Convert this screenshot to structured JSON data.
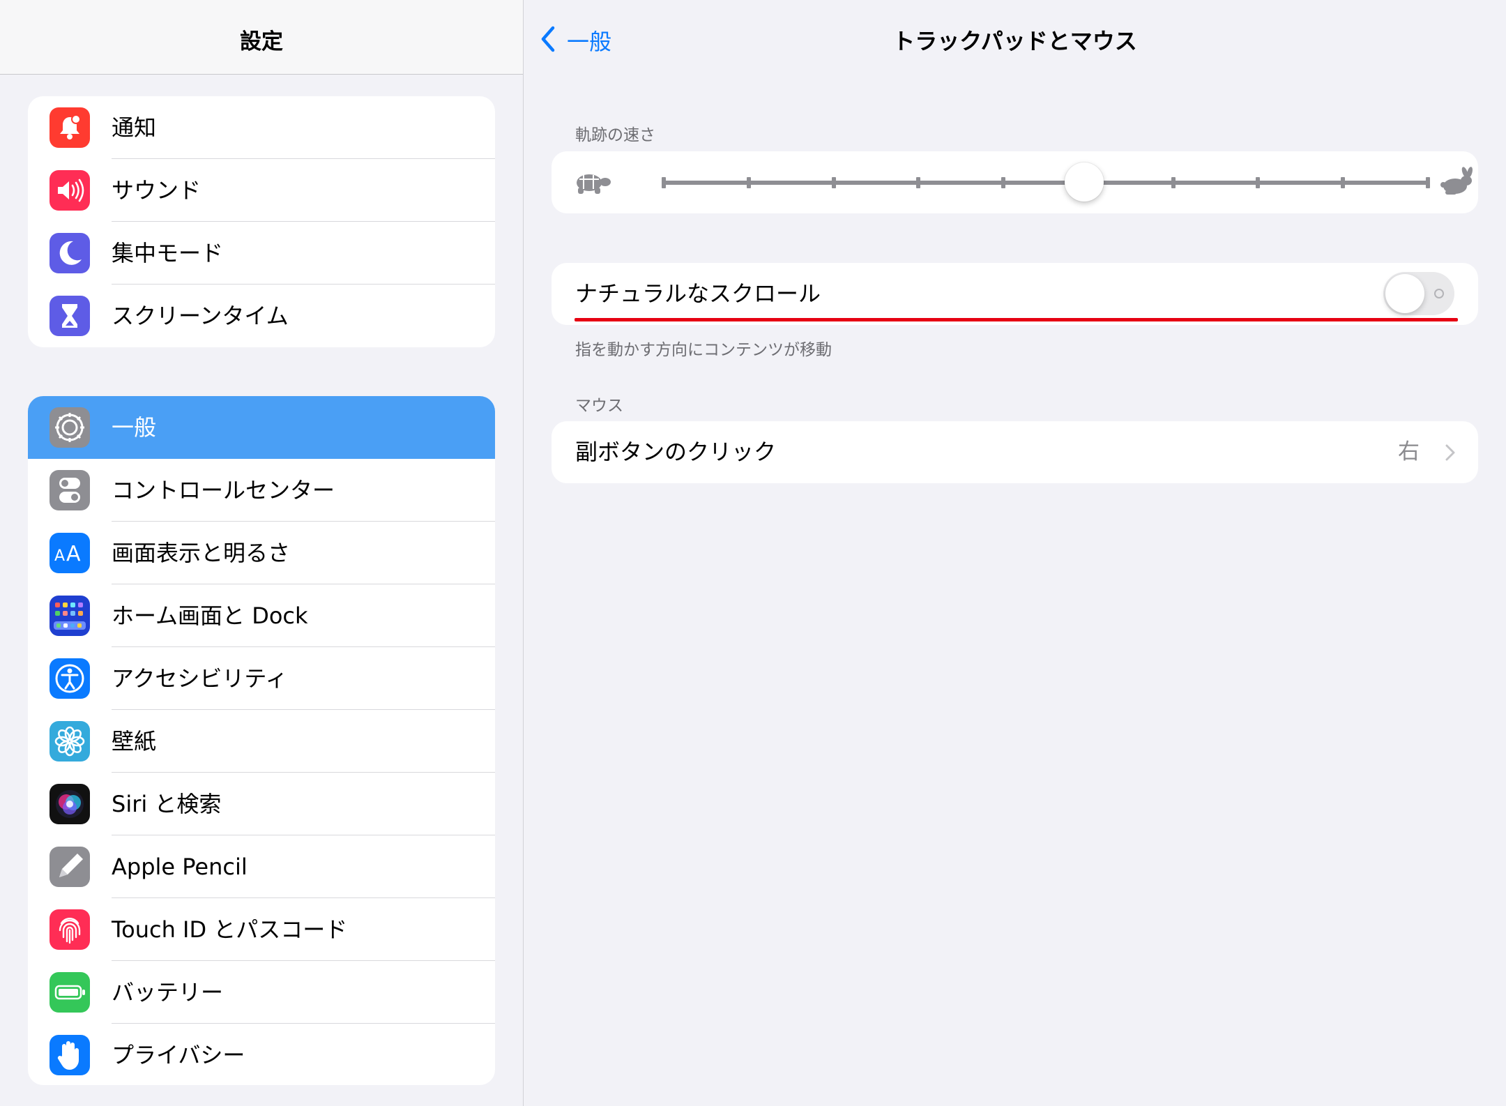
{
  "sidebar": {
    "title": "設定",
    "group1": [
      {
        "label": "通知",
        "icon": "notifications-icon",
        "color": "#ff3b30"
      },
      {
        "label": "サウンド",
        "icon": "speaker-icon",
        "color": "#ff2d55"
      },
      {
        "label": "集中モード",
        "icon": "moon-icon",
        "color": "#5e5ce6"
      },
      {
        "label": "スクリーンタイム",
        "icon": "hourglass-icon",
        "color": "#5e5ce6"
      }
    ],
    "group2": [
      {
        "label": "一般",
        "icon": "gear-icon",
        "color": "#8e8e93",
        "selected": true
      },
      {
        "label": "コントロールセンター",
        "icon": "toggles-icon",
        "color": "#8e8e93"
      },
      {
        "label": "画面表示と明るさ",
        "icon": "text-size-icon",
        "color": "#0a7aff"
      },
      {
        "label": "ホーム画面と Dock",
        "icon": "home-screen-icon",
        "color": "#1f3fd0"
      },
      {
        "label": "アクセシビリティ",
        "icon": "accessibility-icon",
        "color": "#0a7aff"
      },
      {
        "label": "壁紙",
        "icon": "flower-icon",
        "color": "#34aadc"
      },
      {
        "label": "Siri と検索",
        "icon": "siri-icon",
        "color": "#111111"
      },
      {
        "label": "Apple Pencil",
        "icon": "pencil-icon",
        "color": "#8e8e93"
      },
      {
        "label": "Touch ID とパスコード",
        "icon": "fingerprint-icon",
        "color": "#ff2d55"
      },
      {
        "label": "バッテリー",
        "icon": "battery-icon",
        "color": "#34c759"
      },
      {
        "label": "プライバシー",
        "icon": "hand-icon",
        "color": "#0a7aff"
      }
    ]
  },
  "main": {
    "back_label": "一般",
    "title": "トラックパッドとマウス",
    "speed_section": "軌跡の速さ",
    "speed_value": 0.55,
    "natural_scroll_label": "ナチュラルなスクロール",
    "natural_scroll_on": false,
    "natural_scroll_footer": "指を動かす方向にコンテンツが移動",
    "mouse_section": "マウス",
    "secondary_click_label": "副ボタンのクリック",
    "secondary_click_value": "右"
  },
  "colors": {
    "accent": "#0a7aff",
    "selected_row": "#4a9ff5",
    "annotation_red": "#e60012"
  }
}
